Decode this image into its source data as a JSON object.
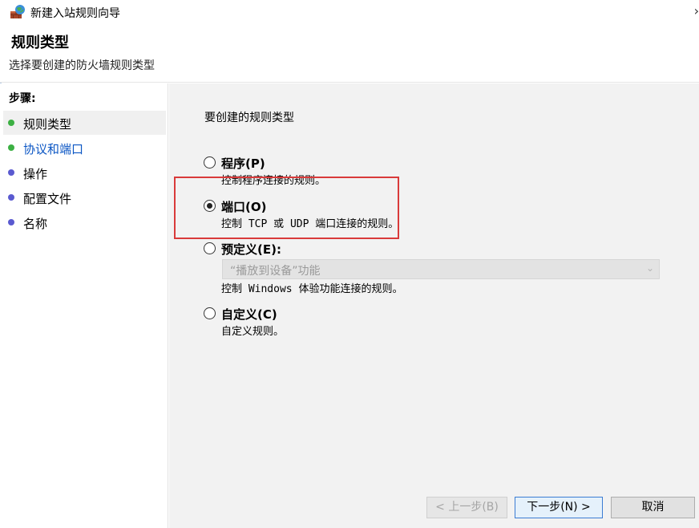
{
  "window": {
    "title": "新建入站规则向导",
    "app_icon": "firewall-icon",
    "close_glyph": "›"
  },
  "header": {
    "title": "规则类型",
    "subtitle": "选择要创建的防火墙规则类型"
  },
  "steps": {
    "title": "步骤:",
    "items": [
      {
        "label": "规则类型",
        "status": "done",
        "active": true,
        "color": "#3cb043"
      },
      {
        "label": "协议和端口",
        "status": "done",
        "active": false,
        "link": true,
        "color": "#3cb043"
      },
      {
        "label": "操作",
        "status": "pending",
        "active": false,
        "color": "#5a5ad0"
      },
      {
        "label": "配置文件",
        "status": "pending",
        "active": false,
        "color": "#5a5ad0"
      },
      {
        "label": "名称",
        "status": "pending",
        "active": false,
        "color": "#5a5ad0"
      }
    ]
  },
  "main": {
    "prompt": "要创建的规则类型",
    "options": [
      {
        "label": "程序(P)",
        "desc": "控制程序连接的规则。",
        "checked": false
      },
      {
        "label": "端口(O)",
        "desc": "控制 TCP 或 UDP 端口连接的规则。",
        "checked": true
      },
      {
        "label": "预定义(E):",
        "desc": "控制 Windows 体验功能连接的规则。",
        "checked": false
      },
      {
        "label": "自定义(C)",
        "desc": "自定义规则。",
        "checked": false
      }
    ],
    "predefined_select": {
      "value": "“播放到设备”功能",
      "enabled": false
    }
  },
  "buttons": {
    "back": "< 上一步(B)",
    "next": "下一步(N) >",
    "cancel": "取消"
  },
  "colors": {
    "highlight": "#d93a3a",
    "link": "#0b56c4",
    "primary_border": "#3b7cd3"
  }
}
